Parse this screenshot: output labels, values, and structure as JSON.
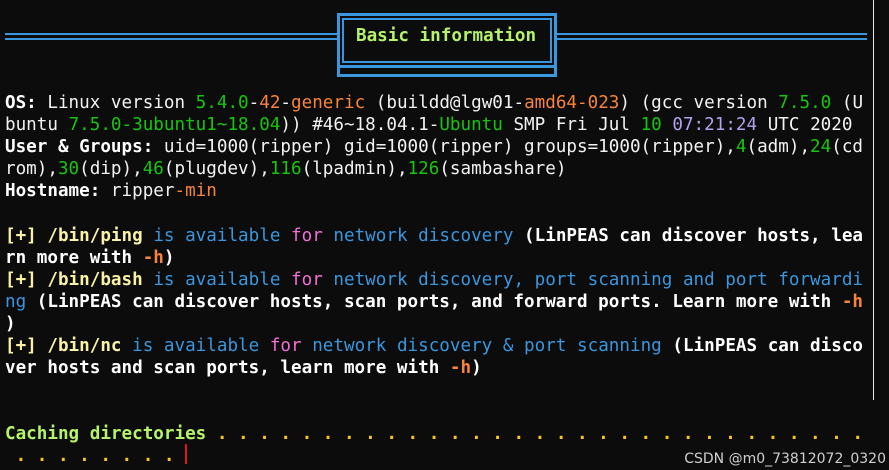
{
  "section": {
    "title": "Basic information"
  },
  "os": {
    "label": "OS:",
    "t1": " Linux version ",
    "ver_a": "5.4.0",
    "dash1": "-",
    "ver_b": "42",
    "dash2": "-",
    "ver_c": "generic",
    "t2": " (buildd@lgw01-",
    "build": "amd64-023",
    "t3": ") (gcc version ",
    "gcc": "7.5.0",
    "t4": " (U",
    "l2a": "buntu ",
    "l2b": "7.5.0",
    "l2c": "-3ubuntu1~18.04",
    "l2d": ")) #46~18.04.1-",
    "l2e": "Ubuntu",
    "l2f": " SMP Fri Jul ",
    "l2g": "10",
    "l2h": " ",
    "l2i": "07:21:24",
    "l2j": " UTC 2020"
  },
  "groups": {
    "label": "User & Groups:",
    "l1": " uid=1000(ripper) gid=1000(ripper) groups=1000(ripper),",
    "n4": "4",
    "adm": "(adm),",
    "n24": "24",
    "cd": "(cd",
    "l2a": "rom),",
    "n30": "30",
    "dip": "(dip),",
    "n46": "46",
    "plug": "(plugdev),",
    "n116": "116",
    "lpad": "(lpadmin),",
    "n126": "126",
    "samba": "(sambashare)"
  },
  "hostname": {
    "label": "Hostname:",
    "v1": " ripper",
    "v2": "-min"
  },
  "tools": [
    {
      "prefix": "[+]",
      "path": "/bin/ping",
      "is_avail": "is available",
      "for": "for",
      "desc_a": "network discovery",
      "rest1": " (LinPEAS can discover hosts, lea",
      "rest2a": "rn more with ",
      "rest2b": "-h",
      "rest2c": ")"
    },
    {
      "prefix": "[+]",
      "path": "/bin/bash",
      "is_avail": "is available",
      "for": "for",
      "desc_a": "network discovery, port scanning and port forwardi",
      "rest2a": "ng",
      "rest2b": " (LinPEAS can discover hosts, scan ports, and forward ports. Learn more with ",
      "rest2c": "-h",
      "rest3": ")"
    },
    {
      "prefix": "[+]",
      "path": "/bin/nc",
      "is_avail": "is available",
      "for": "for",
      "desc_a": "network discovery & port scanning",
      "rest1": " (LinPEAS can disco",
      "rest2a": "ver hosts and scan ports, learn more with ",
      "rest2b": "-h",
      "rest2c": ")"
    }
  ],
  "caching": {
    "label": "Caching directories",
    "dots1": " . . . . . . . . . . . . . . . . . . . . . . . . . . . . . . . . . .",
    "dots2": " . . . . . . . ."
  },
  "watermark": "CSDN @m0_73812072_0320"
}
